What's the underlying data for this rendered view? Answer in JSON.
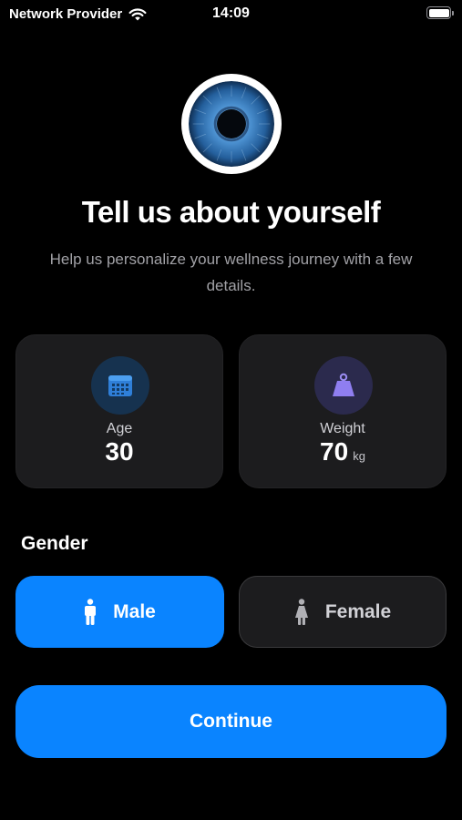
{
  "status_bar": {
    "carrier": "Network Provider",
    "time": "14:09"
  },
  "hero": {
    "title": "Tell us about yourself",
    "subtitle": "Help us personalize your wellness journey with a few details."
  },
  "cards": {
    "age": {
      "label": "Age",
      "value": "30",
      "icon": "calendar-icon"
    },
    "weight": {
      "label": "Weight",
      "value": "70",
      "unit": "kg",
      "icon": "weight-icon"
    }
  },
  "gender": {
    "label": "Gender",
    "options": [
      {
        "label": "Male",
        "icon": "male-icon",
        "selected": true
      },
      {
        "label": "Female",
        "icon": "female-icon",
        "selected": false
      }
    ]
  },
  "continue_label": "Continue",
  "colors": {
    "accent": "#0a84ff",
    "background": "#000000",
    "card": "#1c1c1e"
  }
}
